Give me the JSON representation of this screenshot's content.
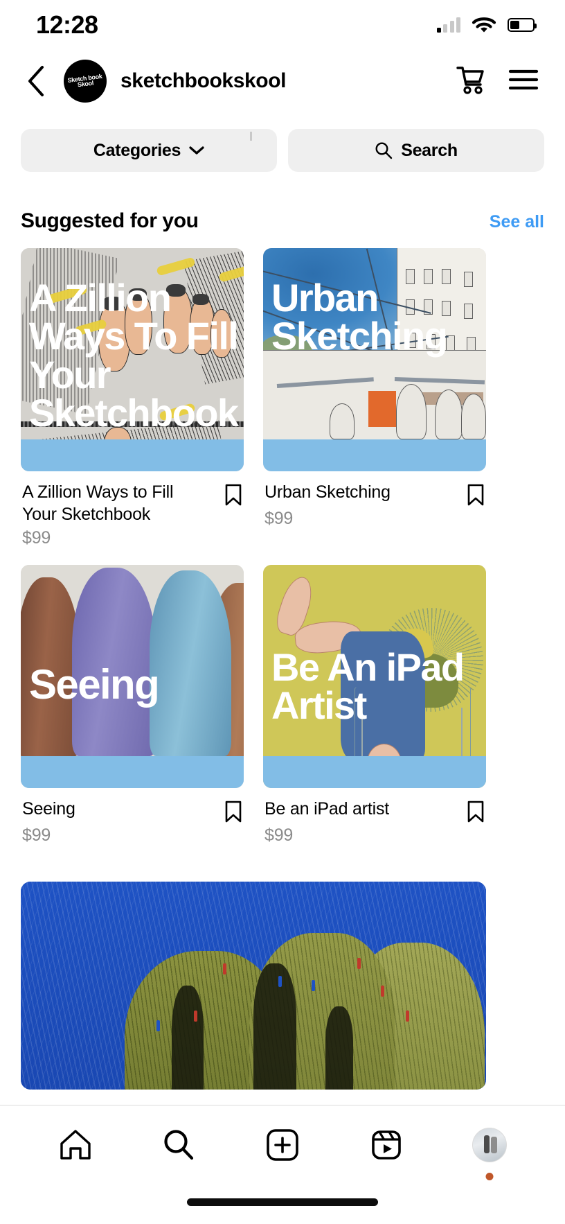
{
  "status_bar": {
    "time": "12:28",
    "icons": [
      "cellular-signal-icon",
      "wifi-icon",
      "battery-icon"
    ],
    "battery_level_percent": 42
  },
  "header": {
    "back_icon": "chevron-left-icon",
    "brand_avatar_text": "Sketch book Skool",
    "brand_name": "sketchbookskool",
    "actions": [
      {
        "name": "shopping-cart-icon",
        "label": "Cart"
      },
      {
        "name": "hamburger-menu-icon",
        "label": "Menu"
      }
    ]
  },
  "filters": {
    "categories": {
      "label": "Categories",
      "icon": "chevron-down-icon"
    },
    "search": {
      "label": "Search",
      "icon": "search-icon"
    }
  },
  "section": {
    "title": "Suggested for you",
    "see_all": "See all",
    "see_all_color": "#3E9BF4"
  },
  "products": [
    {
      "overlay_title": "A Zillion Ways To Fill Your Sketchbook",
      "title": "A Zillion Ways to Fill Your Sketchbook",
      "price": "$99",
      "bookmark_icon": "bookmark-icon",
      "art": "sketched-feet-with-highlighters"
    },
    {
      "overlay_title": "Urban Sketching",
      "title": "Urban Sketching",
      "price": "$99",
      "bookmark_icon": "bookmark-icon",
      "art": "urban-street-watercolor-sketch"
    },
    {
      "overlay_title": "Seeing",
      "title": "Seeing",
      "price": "$99",
      "bookmark_icon": "bookmark-icon",
      "art": "colored-pencil-sleeves"
    },
    {
      "overlay_title": "Be An iPad Artist",
      "title": "Be an iPad artist",
      "price": "$99",
      "bookmark_icon": "bookmark-icon",
      "art": "olive-digital-illustration-person-on-chair"
    },
    {
      "overlay_title": "",
      "title": "",
      "price": "",
      "bookmark_icon": "bookmark-icon",
      "art": "crayon-landscape-blue-sky-green-hills"
    }
  ],
  "card_strip_color": "#82bde6",
  "tabbar": {
    "items": [
      {
        "name": "tab-home",
        "icon": "home-icon"
      },
      {
        "name": "tab-search",
        "icon": "search-icon"
      },
      {
        "name": "tab-create",
        "icon": "plus-square-icon"
      },
      {
        "name": "tab-reels",
        "icon": "reels-icon"
      },
      {
        "name": "tab-profile",
        "icon": "profile-avatar"
      }
    ],
    "profile_notification_dot_color": "#C0572A"
  }
}
